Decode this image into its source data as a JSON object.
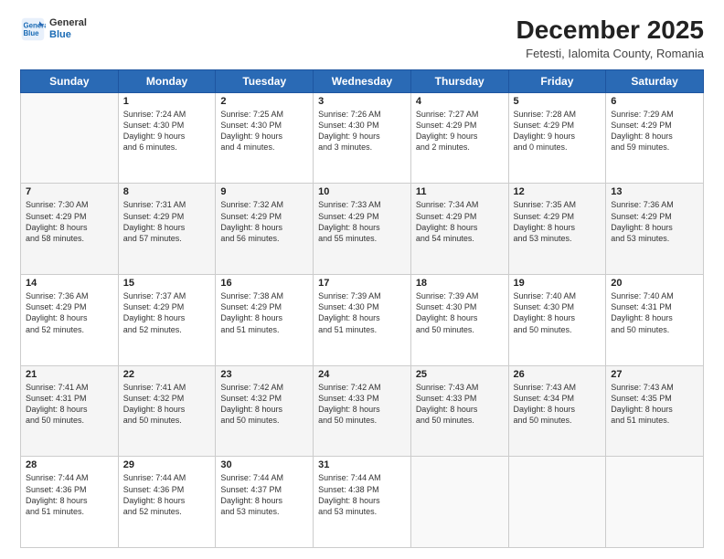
{
  "logo": {
    "line1": "General",
    "line2": "Blue"
  },
  "title": "December 2025",
  "subtitle": "Fetesti, Ialomita County, Romania",
  "weekdays": [
    "Sunday",
    "Monday",
    "Tuesday",
    "Wednesday",
    "Thursday",
    "Friday",
    "Saturday"
  ],
  "weeks": [
    [
      {
        "day": "",
        "info": ""
      },
      {
        "day": "1",
        "info": "Sunrise: 7:24 AM\nSunset: 4:30 PM\nDaylight: 9 hours\nand 6 minutes."
      },
      {
        "day": "2",
        "info": "Sunrise: 7:25 AM\nSunset: 4:30 PM\nDaylight: 9 hours\nand 4 minutes."
      },
      {
        "day": "3",
        "info": "Sunrise: 7:26 AM\nSunset: 4:30 PM\nDaylight: 9 hours\nand 3 minutes."
      },
      {
        "day": "4",
        "info": "Sunrise: 7:27 AM\nSunset: 4:29 PM\nDaylight: 9 hours\nand 2 minutes."
      },
      {
        "day": "5",
        "info": "Sunrise: 7:28 AM\nSunset: 4:29 PM\nDaylight: 9 hours\nand 0 minutes."
      },
      {
        "day": "6",
        "info": "Sunrise: 7:29 AM\nSunset: 4:29 PM\nDaylight: 8 hours\nand 59 minutes."
      }
    ],
    [
      {
        "day": "7",
        "info": "Sunrise: 7:30 AM\nSunset: 4:29 PM\nDaylight: 8 hours\nand 58 minutes."
      },
      {
        "day": "8",
        "info": "Sunrise: 7:31 AM\nSunset: 4:29 PM\nDaylight: 8 hours\nand 57 minutes."
      },
      {
        "day": "9",
        "info": "Sunrise: 7:32 AM\nSunset: 4:29 PM\nDaylight: 8 hours\nand 56 minutes."
      },
      {
        "day": "10",
        "info": "Sunrise: 7:33 AM\nSunset: 4:29 PM\nDaylight: 8 hours\nand 55 minutes."
      },
      {
        "day": "11",
        "info": "Sunrise: 7:34 AM\nSunset: 4:29 PM\nDaylight: 8 hours\nand 54 minutes."
      },
      {
        "day": "12",
        "info": "Sunrise: 7:35 AM\nSunset: 4:29 PM\nDaylight: 8 hours\nand 53 minutes."
      },
      {
        "day": "13",
        "info": "Sunrise: 7:36 AM\nSunset: 4:29 PM\nDaylight: 8 hours\nand 53 minutes."
      }
    ],
    [
      {
        "day": "14",
        "info": "Sunrise: 7:36 AM\nSunset: 4:29 PM\nDaylight: 8 hours\nand 52 minutes."
      },
      {
        "day": "15",
        "info": "Sunrise: 7:37 AM\nSunset: 4:29 PM\nDaylight: 8 hours\nand 52 minutes."
      },
      {
        "day": "16",
        "info": "Sunrise: 7:38 AM\nSunset: 4:29 PM\nDaylight: 8 hours\nand 51 minutes."
      },
      {
        "day": "17",
        "info": "Sunrise: 7:39 AM\nSunset: 4:30 PM\nDaylight: 8 hours\nand 51 minutes."
      },
      {
        "day": "18",
        "info": "Sunrise: 7:39 AM\nSunset: 4:30 PM\nDaylight: 8 hours\nand 50 minutes."
      },
      {
        "day": "19",
        "info": "Sunrise: 7:40 AM\nSunset: 4:30 PM\nDaylight: 8 hours\nand 50 minutes."
      },
      {
        "day": "20",
        "info": "Sunrise: 7:40 AM\nSunset: 4:31 PM\nDaylight: 8 hours\nand 50 minutes."
      }
    ],
    [
      {
        "day": "21",
        "info": "Sunrise: 7:41 AM\nSunset: 4:31 PM\nDaylight: 8 hours\nand 50 minutes."
      },
      {
        "day": "22",
        "info": "Sunrise: 7:41 AM\nSunset: 4:32 PM\nDaylight: 8 hours\nand 50 minutes."
      },
      {
        "day": "23",
        "info": "Sunrise: 7:42 AM\nSunset: 4:32 PM\nDaylight: 8 hours\nand 50 minutes."
      },
      {
        "day": "24",
        "info": "Sunrise: 7:42 AM\nSunset: 4:33 PM\nDaylight: 8 hours\nand 50 minutes."
      },
      {
        "day": "25",
        "info": "Sunrise: 7:43 AM\nSunset: 4:33 PM\nDaylight: 8 hours\nand 50 minutes."
      },
      {
        "day": "26",
        "info": "Sunrise: 7:43 AM\nSunset: 4:34 PM\nDaylight: 8 hours\nand 50 minutes."
      },
      {
        "day": "27",
        "info": "Sunrise: 7:43 AM\nSunset: 4:35 PM\nDaylight: 8 hours\nand 51 minutes."
      }
    ],
    [
      {
        "day": "28",
        "info": "Sunrise: 7:44 AM\nSunset: 4:36 PM\nDaylight: 8 hours\nand 51 minutes."
      },
      {
        "day": "29",
        "info": "Sunrise: 7:44 AM\nSunset: 4:36 PM\nDaylight: 8 hours\nand 52 minutes."
      },
      {
        "day": "30",
        "info": "Sunrise: 7:44 AM\nSunset: 4:37 PM\nDaylight: 8 hours\nand 53 minutes."
      },
      {
        "day": "31",
        "info": "Sunrise: 7:44 AM\nSunset: 4:38 PM\nDaylight: 8 hours\nand 53 minutes."
      },
      {
        "day": "",
        "info": ""
      },
      {
        "day": "",
        "info": ""
      },
      {
        "day": "",
        "info": ""
      }
    ]
  ]
}
